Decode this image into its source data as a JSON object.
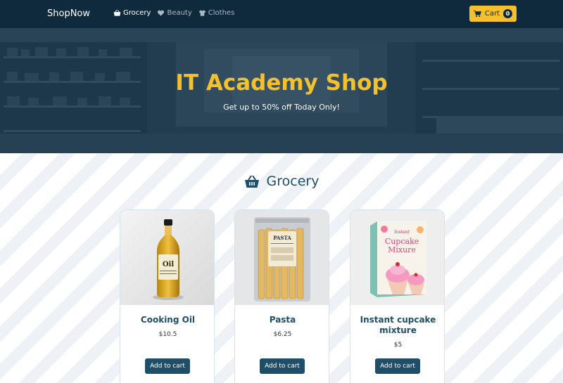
{
  "navbar": {
    "brand": "ShopNow",
    "links": [
      {
        "label": "Grocery",
        "icon": "basket-icon",
        "active": true
      },
      {
        "label": "Beauty",
        "icon": "heart-icon",
        "active": false
      },
      {
        "label": "Clothes",
        "icon": "shirt-icon",
        "active": false
      }
    ],
    "cart_label": "Cart",
    "cart_count": "0"
  },
  "hero": {
    "title": "IT Academy Shop",
    "subtitle": "Get up to 50% off Today Only!"
  },
  "section": {
    "title": "Grocery",
    "icon": "basket-icon"
  },
  "products": [
    {
      "name": "Cooking Oil",
      "price": "$10.5",
      "button": "Add to cart",
      "image": "oil-bottle"
    },
    {
      "name": "Pasta",
      "price": "$6.25",
      "button": "Add to cart",
      "image": "pasta-bag"
    },
    {
      "name": "Instant cupcake mixture",
      "price": "$5",
      "button": "Add to cart",
      "image": "cupcake-box"
    }
  ],
  "product_images": {
    "oil_label_line1": "Oil",
    "pasta_label": "PASTA",
    "cupcake_brand": "Instant",
    "cupcake_line1": "Cupcake",
    "cupcake_line2": "Mixure"
  },
  "colors": {
    "navbar": "#0f2a3d",
    "accent": "#f4c02b",
    "primary": "#1f4e69"
  }
}
